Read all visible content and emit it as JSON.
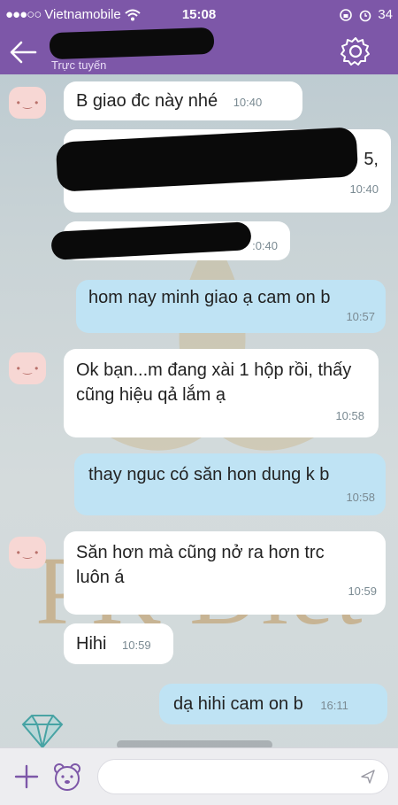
{
  "status": {
    "carrier": "Vietnamobile",
    "time": "15:08",
    "battery": "34"
  },
  "header": {
    "subtitle": "Trực tuyến"
  },
  "watermark": "PK Diet",
  "messages": [
    {
      "dir": "in",
      "text": "B giao đc này nhé",
      "time": "10:40"
    },
    {
      "dir": "in",
      "text": "",
      "time": "10:40",
      "partial": "5,"
    },
    {
      "dir": "in",
      "text": "",
      "time": ":0:40"
    },
    {
      "dir": "out",
      "text": "hom nay minh giao ạ cam on b",
      "time": "10:57"
    },
    {
      "dir": "in",
      "text": "Ok bạn...m đang xài 1 hộp rồi, thấy cũng hiệu qả lắm ạ",
      "time": "10:58"
    },
    {
      "dir": "out",
      "text": "thay nguc có săn hon dung k b",
      "time": "10:58"
    },
    {
      "dir": "in",
      "text": "Săn hơn mà cũng nở ra hơn trc luôn á",
      "time": "10:59"
    },
    {
      "dir": "in",
      "text": "Hihi",
      "time": "10:59"
    },
    {
      "dir": "out",
      "text": "dạ hihi cam on b",
      "time": "16:11"
    }
  ],
  "colors": {
    "header": "#7d57a8",
    "incoming": "#ffffff",
    "outgoing": "#bfe3f4"
  }
}
